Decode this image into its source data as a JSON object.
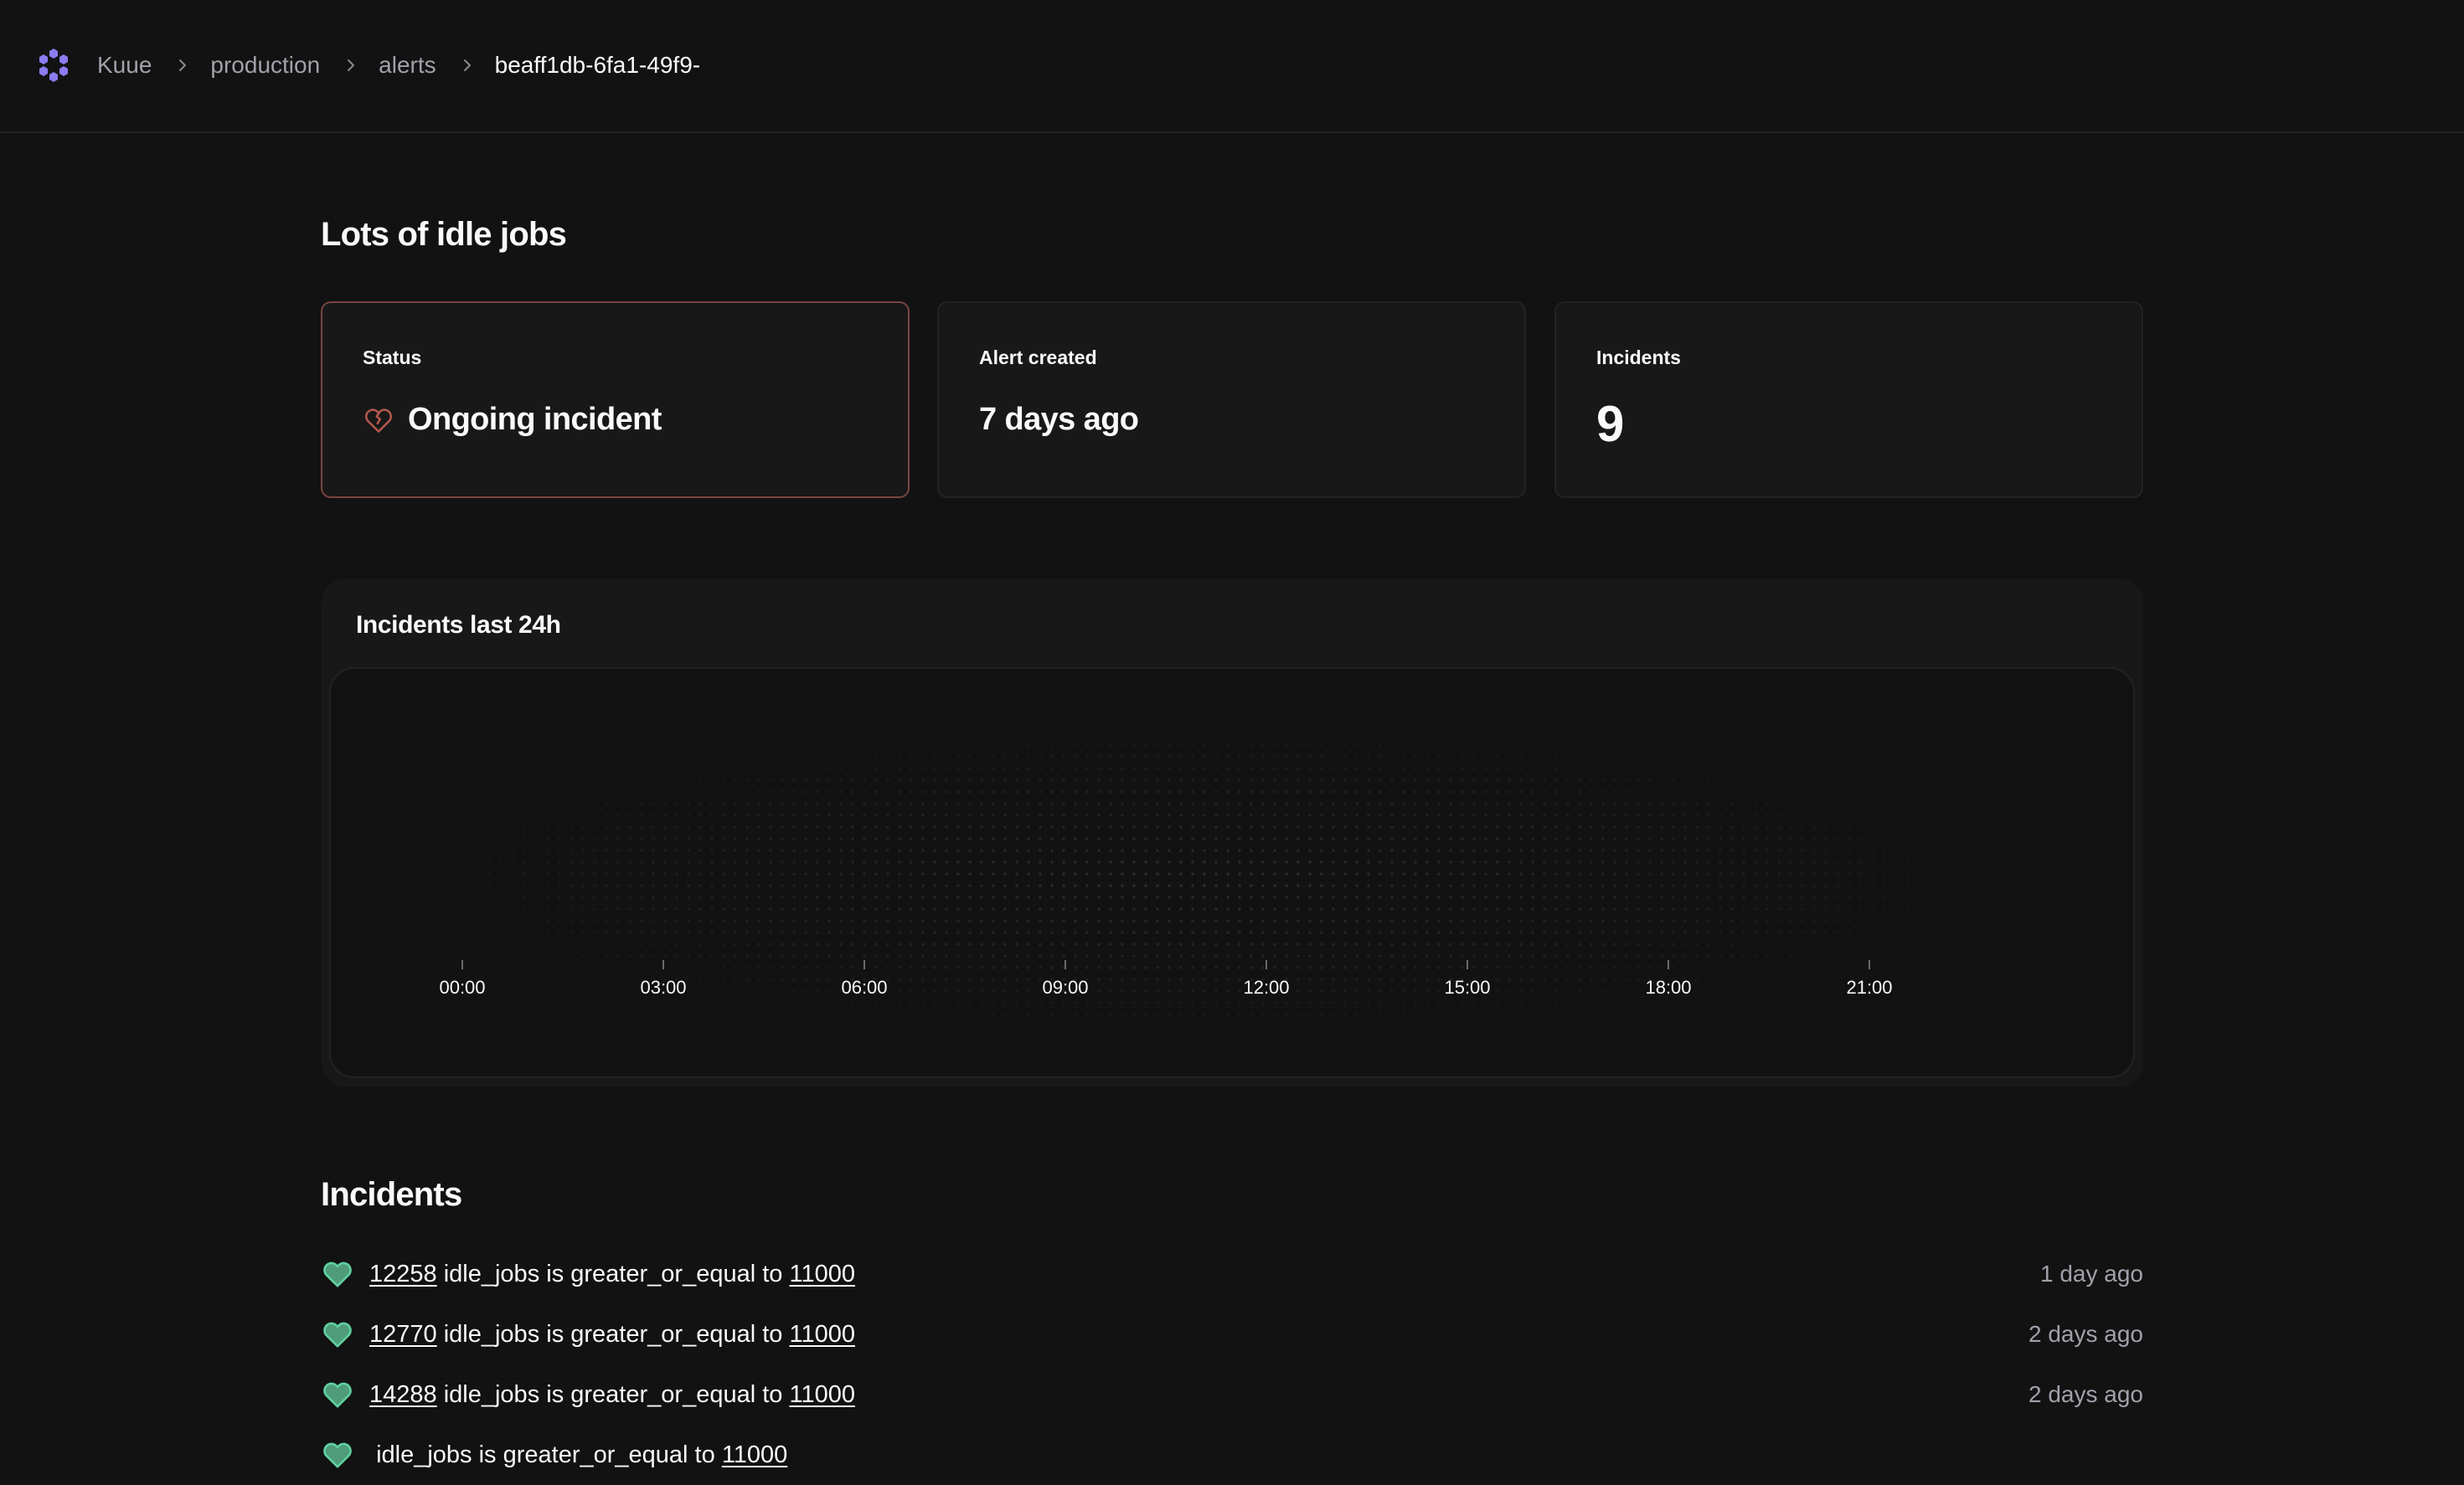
{
  "header": {
    "logo_icon": "hexagon-ring-logo-icon",
    "breadcrumb": [
      {
        "label": "Kuue"
      },
      {
        "label": "production"
      },
      {
        "label": "alerts"
      },
      {
        "label": "beaff1db-6fa1-49f9-"
      }
    ],
    "separator_icon": "chevron-right-icon"
  },
  "page": {
    "title": "Lots of idle jobs"
  },
  "cards": {
    "status": {
      "label": "Status",
      "value": "Ongoing incident",
      "icon": "broken-heart-icon"
    },
    "created": {
      "label": "Alert created",
      "value": "7 days ago"
    },
    "incidents": {
      "label": "Incidents",
      "value": "9"
    }
  },
  "colors": {
    "accent_logo": "#8b7cf0",
    "alert_border": "#7a4540",
    "broken_heart": "#b4574d",
    "healthy_heart_fill": "#4f9b7a",
    "healthy_heart_stroke": "#5fd0a0",
    "muted_text": "#a1a1aa"
  },
  "chart_data": {
    "type": "bar",
    "title": "Incidents last 24h",
    "xlabel": "",
    "ylabel": "",
    "x_ticks": [
      "00:00",
      "03:00",
      "06:00",
      "09:00",
      "12:00",
      "15:00",
      "18:00",
      "21:00"
    ],
    "x_range_hours": [
      0,
      24
    ],
    "series": [
      {
        "name": "Incidents",
        "values": []
      }
    ],
    "grid": "dotted background",
    "legend": "none"
  },
  "incidents_section": {
    "title": "Incidents",
    "items": [
      {
        "value": "12258",
        "metric": "idle_jobs",
        "operator": "is greater_or_equal to",
        "threshold": "11000",
        "ago": "1 day ago",
        "icon": "heart-icon"
      },
      {
        "value": "12770",
        "metric": "idle_jobs",
        "operator": "is greater_or_equal to",
        "threshold": "11000",
        "ago": "2 days ago",
        "icon": "heart-icon"
      },
      {
        "value": "14288",
        "metric": "idle_jobs",
        "operator": "is greater_or_equal to",
        "threshold": "11000",
        "ago": "2 days ago",
        "icon": "heart-icon"
      },
      {
        "value": "",
        "metric": "idle_jobs",
        "operator": "is greater_or_equal to",
        "threshold": "11000",
        "ago": "",
        "icon": "heart-icon"
      }
    ]
  }
}
